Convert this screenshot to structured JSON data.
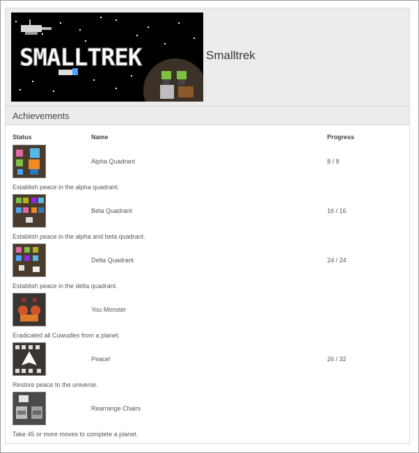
{
  "header": {
    "banner_text": "SMALLTREK",
    "game_title": "Smalltrek"
  },
  "achievements": {
    "section_title": "Achievements",
    "columns": {
      "status": "Status",
      "name": "Name",
      "progress": "Progress"
    },
    "rows": [
      {
        "name": "Alpha Quadrant",
        "progress": "8 / 8",
        "description": "Establish peace in the alpha quadrant.",
        "icon": "alpha-quadrant-badge-icon"
      },
      {
        "name": "Beta Quadrant",
        "progress": "16 / 16",
        "description": "Establish peace in the alpha and beta quadrant.",
        "icon": "beta-quadrant-badge-icon"
      },
      {
        "name": "Delta Quadrant",
        "progress": "24 / 24",
        "description": "Establish peace in the delta quadrant.",
        "icon": "delta-quadrant-badge-icon"
      },
      {
        "name": "You Monster",
        "progress": "",
        "description": "Eradicated all Cuwudles from a planet.",
        "icon": "you-monster-badge-icon"
      },
      {
        "name": "Peace!",
        "progress": "26 / 32",
        "description": "Restore peace to the universe.",
        "icon": "peace-badge-icon"
      },
      {
        "name": "Rearrange Chairs",
        "progress": "",
        "description": "Take 45 or more moves to complete a planet.",
        "icon": "rearrange-chairs-badge-icon"
      }
    ]
  },
  "colors": {
    "header_bg": "#ececec",
    "banner_bg": "#000000"
  }
}
